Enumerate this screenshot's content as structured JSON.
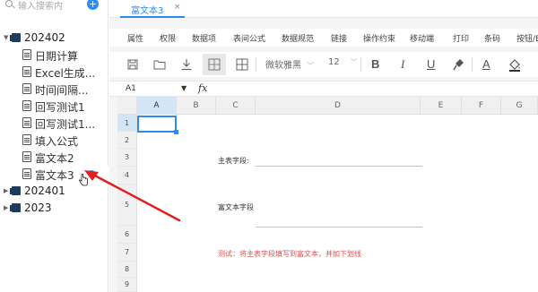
{
  "sidebar": {
    "search_placeholder": "输入搜索内",
    "add_label": "+",
    "tree": [
      {
        "label": "202402",
        "expanded": true
      },
      {
        "label": "日期计算"
      },
      {
        "label": "Excel生成..."
      },
      {
        "label": "时间间隔..."
      },
      {
        "label": "回写测试1"
      },
      {
        "label": "回写测试1..."
      },
      {
        "label": "填入公式"
      },
      {
        "label": "富文本2"
      },
      {
        "label": "富文本3",
        "active": true
      },
      {
        "label": "202401",
        "expanded": false
      },
      {
        "label": "2023",
        "expanded": false
      }
    ]
  },
  "tabs": [
    {
      "label": "富文本3",
      "close": "×"
    }
  ],
  "menu": [
    "属性",
    "权限",
    "数据项",
    "表间公式",
    "数据规范",
    "链接",
    "操作约束",
    "移动端",
    "打印",
    "条码",
    "按钮/E"
  ],
  "toolbar": {
    "font_name": "微软雅黑",
    "font_size": "12",
    "chevron": "﹀",
    "bold": "B",
    "italic": "I",
    "underline": "U",
    "font_color": "A"
  },
  "formula_bar": {
    "cell_ref": "A1",
    "ref_chevron": "▼",
    "fx": "fx"
  },
  "sheet": {
    "columns": [
      "A",
      "B",
      "C",
      "D",
      "E",
      "F",
      "G"
    ],
    "rows": [
      "1",
      "2",
      "3",
      "4",
      "5",
      "6",
      "7",
      "8",
      "9"
    ],
    "selected_cell": "A1",
    "cells": {
      "main_field_label": "主表字段:",
      "rich_text_label": "富文本字段",
      "note": "测试：将主表字段填写到富文本，并加下划线"
    }
  },
  "colors": {
    "accent": "#2e8cf0",
    "folder": "#1f3a5f",
    "note_red": "#e34d4d",
    "arrow_red": "#e02020"
  }
}
